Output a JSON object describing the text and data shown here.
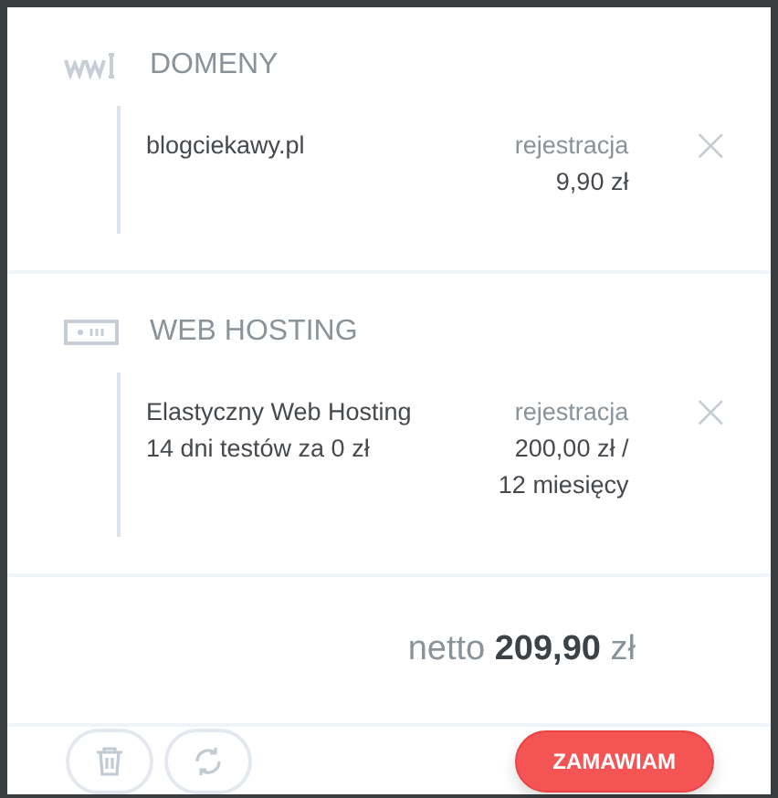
{
  "sections": [
    {
      "kind": "domain",
      "title": "DOMENY",
      "items": [
        {
          "name_lines": [
            "blogciekawy.pl"
          ],
          "price_lines": [
            "rejestracja",
            "9,90 zł"
          ],
          "remove": "×"
        }
      ]
    },
    {
      "kind": "hosting",
      "title": "WEB HOSTING",
      "items": [
        {
          "name_lines": [
            "Elastyczny Web Hosting",
            "14 dni testów za 0 zł"
          ],
          "price_lines": [
            "rejestracja",
            "200,00 zł /",
            "12 miesięcy"
          ],
          "remove": "×"
        }
      ]
    }
  ],
  "total": {
    "prefix": "netto",
    "amount": "209,90",
    "currency": "zł"
  },
  "actions": [
    {
      "kind": "trash"
    },
    {
      "kind": "refresh"
    }
  ],
  "order_button": "ZAMAWIAM"
}
